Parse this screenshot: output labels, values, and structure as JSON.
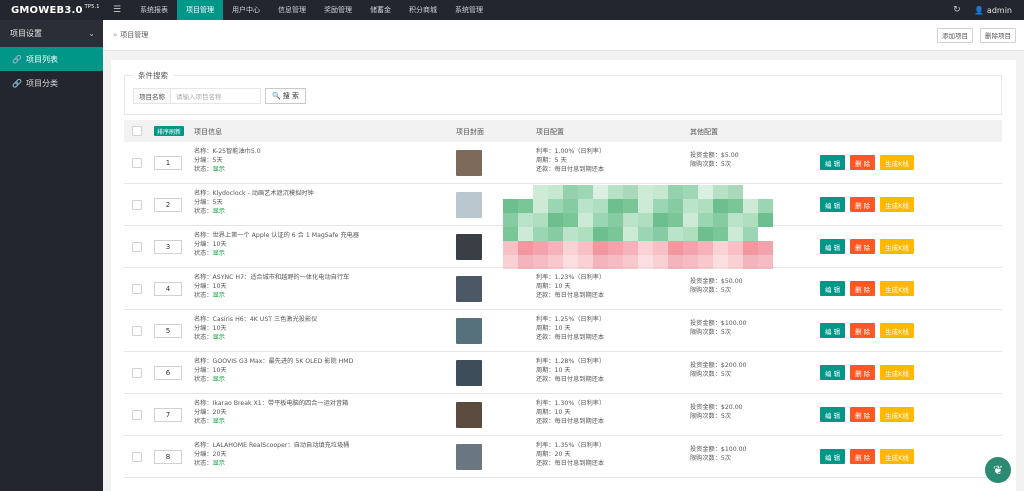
{
  "brand": {
    "name": "GMOWEB3.0",
    "version": "TP5.1"
  },
  "topnav": [
    {
      "label": "系统报表",
      "active": false
    },
    {
      "label": "项目管理",
      "active": true
    },
    {
      "label": "用户中心",
      "active": false
    },
    {
      "label": "信息管理",
      "active": false
    },
    {
      "label": "奖励管理",
      "active": false
    },
    {
      "label": "储蓄金",
      "active": false
    },
    {
      "label": "积分商城",
      "active": false
    },
    {
      "label": "系统管理",
      "active": false
    }
  ],
  "user": {
    "name": "admin",
    "caret": "▾"
  },
  "icons": {
    "menu": "menu-icon",
    "refresh": "refresh-icon",
    "user": "user-icon",
    "link": "link-icon",
    "chevron": "chevron-down-icon",
    "search": "search-icon",
    "fab": "leaf-icon"
  },
  "sidebar": {
    "group": "项目设置",
    "items": [
      {
        "label": "项目列表",
        "active": true
      },
      {
        "label": "项目分类",
        "active": false
      }
    ]
  },
  "breadcrumb": {
    "current": "项目管理"
  },
  "actions": {
    "add": "添加项目",
    "delete": "删除项目"
  },
  "search": {
    "legend": "条件搜索",
    "label": "项目名称",
    "placeholder": "请输入项目名称",
    "button": "搜 索"
  },
  "table": {
    "sort_button": "排序刷新",
    "headers": {
      "info": "项目信息",
      "cover": "项目封面",
      "config": "项目配置",
      "other": "其他配置"
    },
    "buttons": {
      "edit": "编 辑",
      "delete": "删 除",
      "generate": "生成K线"
    },
    "rows": [
      {
        "order": "1",
        "name": "名称：K-25智能油巾5.0",
        "share": "分编：5天",
        "status_label": "状态：",
        "status": "显示",
        "cfg": [
          "利率：1.00%（日利率）",
          "周期：5 天",
          "还款：每日付息到期还本"
        ],
        "other": [
          "投资金额：$5.00",
          "限购次数：5次"
        ],
        "thumb": "#7d6a5a"
      },
      {
        "order": "2",
        "name": "名称：Klydoclock - 动画艺术遮沉模拟时钟",
        "share": "分编：5天",
        "status_label": "状态：",
        "status": "显示",
        "cfg": [],
        "other": [],
        "thumb": "#b9c7cf"
      },
      {
        "order": "3",
        "name": "名称：世界上第一个 Apple 认证的 6 合 1 MagSafe 充电器",
        "share": "分编：10天",
        "status_label": "状态：",
        "status": "显示",
        "cfg": [],
        "other": [],
        "thumb": "#3a3f46"
      },
      {
        "order": "4",
        "name": "名称：ASYNC H7：适合城市和越野的一体化电动自行车",
        "share": "分编：10天",
        "status_label": "状态：",
        "status": "显示",
        "cfg": [
          "利率：1.23%（日利率）",
          "周期：10 天",
          "还款：每日付息到期还本"
        ],
        "other": [
          "投资金额：$50.00",
          "限购次数：5次"
        ],
        "thumb": "#4b5866"
      },
      {
        "order": "5",
        "name": "名称：Casiris H6：4K UST 三色激光投影仪",
        "share": "分编：10天",
        "status_label": "状态：",
        "status": "显示",
        "cfg": [
          "利率：1.25%（日利率）",
          "周期：10 天",
          "还款：每日付息到期还本"
        ],
        "other": [
          "投资金额：$100.00",
          "限购次数：5次"
        ],
        "thumb": "#56707c"
      },
      {
        "order": "6",
        "name": "名称：GOOVIS G3 Max：最先进的 5K OLED 影院 HMD",
        "share": "分编：10天",
        "status_label": "状态：",
        "status": "显示",
        "cfg": [
          "利率：1.28%（日利率）",
          "周期：10 天",
          "还款：每日付息到期还本"
        ],
        "other": [
          "投资金额：$200.00",
          "限购次数：5次"
        ],
        "thumb": "#3d4d5a"
      },
      {
        "order": "7",
        "name": "名称：Ikarao Break X1：带平板电脑的四合一运对音箱",
        "share": "分编：20天",
        "status_label": "状态：",
        "status": "显示",
        "cfg": [
          "利率：1.30%（日利率）",
          "周期：10 天",
          "还款：每日付息到期还本"
        ],
        "other": [
          "投资金额：$20.00",
          "限购次数：5次"
        ],
        "thumb": "#5b4a3e"
      },
      {
        "order": "8",
        "name": "名称：LALAHOME RealScooper：自动自动填充垃圾桶",
        "share": "分编：20天",
        "status_label": "状态：",
        "status": "显示",
        "cfg": [
          "利率：1.35%（日利率）",
          "周期：20 天",
          "还款：每日付息到期还本"
        ],
        "other": [
          "投资金额：$100.00",
          "限购次数：5次"
        ],
        "thumb": "#6a7680"
      }
    ]
  }
}
